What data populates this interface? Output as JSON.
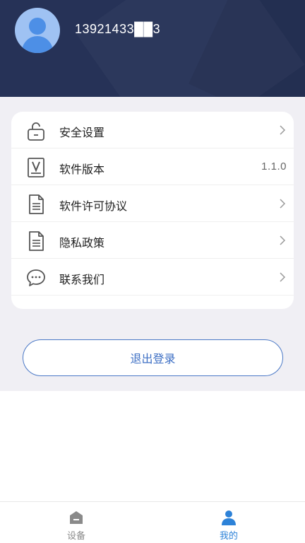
{
  "profile": {
    "phone": "13921433██3"
  },
  "menu": {
    "items": [
      {
        "label": "安全设置",
        "icon": "unlock-icon"
      },
      {
        "label": "软件版本",
        "icon": "version-icon",
        "value": "1.1.0"
      },
      {
        "label": "软件许可协议",
        "icon": "document-icon"
      },
      {
        "label": "隐私政策",
        "icon": "document-icon"
      },
      {
        "label": "联系我们",
        "icon": "chat-bubble-icon"
      }
    ]
  },
  "logout": {
    "label": "退出登录"
  },
  "tabbar": {
    "tabs": [
      {
        "label": "设备",
        "icon": "device-icon",
        "active": false
      },
      {
        "label": "我的",
        "icon": "user-icon",
        "active": true
      }
    ]
  },
  "colors": {
    "header_bg": "#263257",
    "page_bg": "#f0eff4",
    "accent": "#3d6fc4",
    "tab_active": "#2d82d8",
    "tab_inactive": "#8a8a8a"
  }
}
